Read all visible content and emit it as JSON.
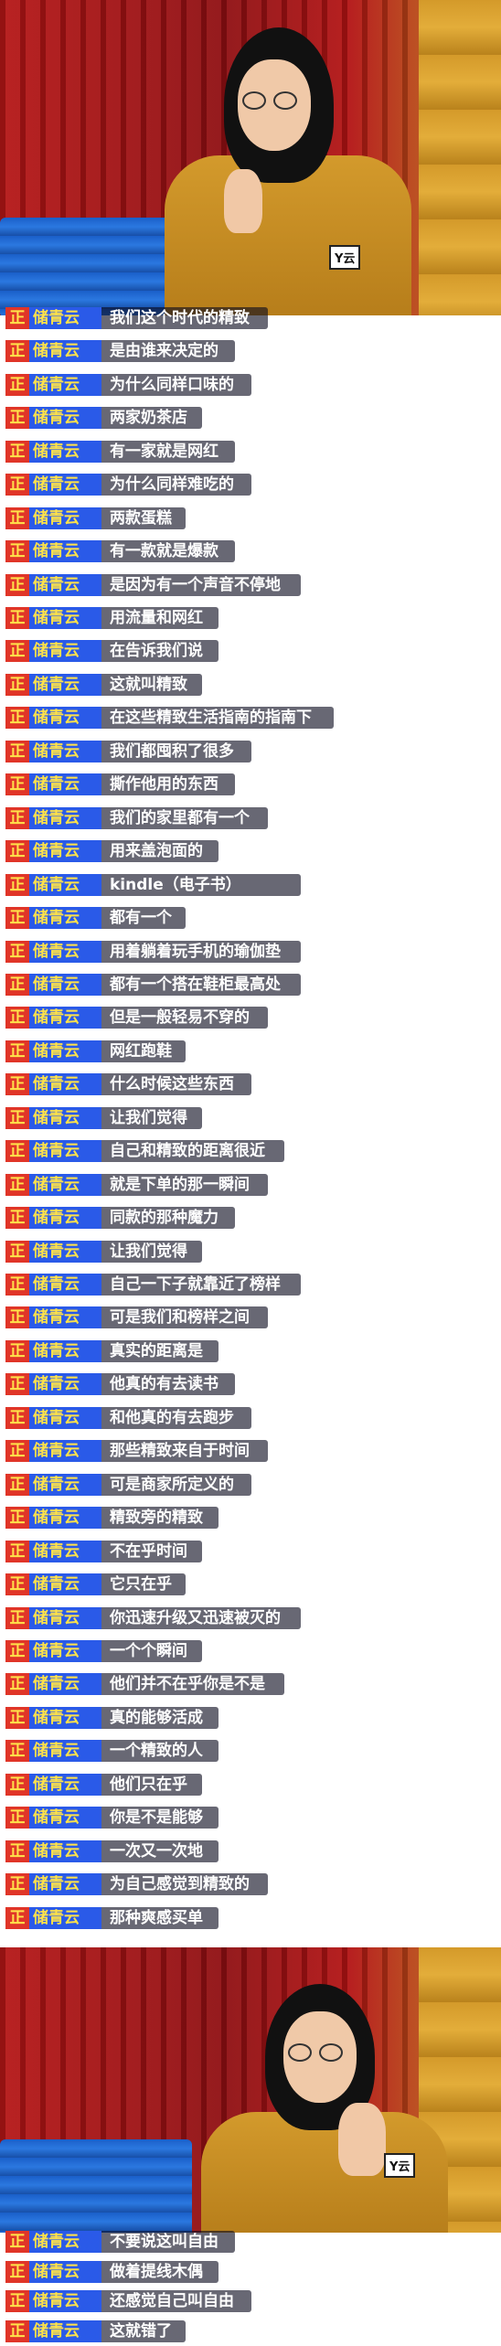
{
  "badge_text": "Y云",
  "speaker": {
    "prefix": "正",
    "name": "储青云"
  },
  "colors": {
    "tag_bg": "#2a5ae8",
    "prefix_bg": "#e03528",
    "name_text": "#ffe24a"
  },
  "captions_a": [
    "我们这个时代的精致",
    "是由谁来决定的",
    "为什么同样口味的",
    "两家奶茶店",
    "有一家就是网红",
    "为什么同样难吃的",
    "两款蛋糕",
    "有一款就是爆款",
    "是因为有一个声音不停地",
    "用流量和网红",
    "在告诉我们说",
    "这就叫精致",
    "在这些精致生活指南的指南下",
    "我们都囤积了很多",
    "撕作他用的东西",
    "我们的家里都有一个",
    "用来盖泡面的",
    "kindle（电子书）",
    "都有一个",
    "用着躺着玩手机的瑜伽垫",
    "都有一个搭在鞋柜最高处",
    "但是一般轻易不穿的",
    "网红跑鞋",
    "什么时候这些东西",
    "让我们觉得",
    "自己和精致的距离很近",
    "就是下单的那一瞬间",
    "同款的那种魔力",
    "让我们觉得",
    "自己一下子就靠近了榜样",
    "可是我们和榜样之间",
    "真实的距离是",
    "他真的有去读书",
    "和他真的有去跑步",
    "那些精致来自于时间",
    "可是商家所定义的",
    "精致旁的精致",
    "不在乎时间",
    "它只在乎",
    "你迅速升级又迅速被灭的",
    "一个个瞬间",
    "他们并不在乎你是不是",
    "真的能够活成",
    "一个精致的人",
    "他们只在乎",
    "你是不是能够",
    "一次又一次地",
    "为自己感觉到精致的",
    "那种爽感买单"
  ],
  "captions_b": [
    "不要说这叫自由",
    "做着提线木偶",
    "还感觉自己叫自由",
    "这就错了"
  ]
}
